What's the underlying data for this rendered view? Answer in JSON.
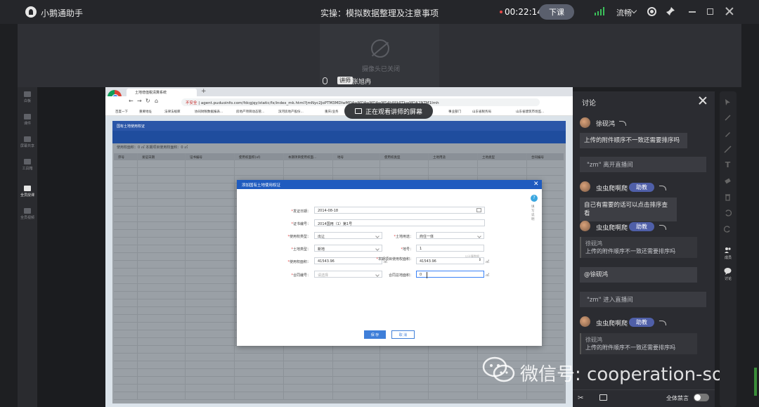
{
  "titlebar": {
    "app_name": "小鹅通助手",
    "class_title": "实操：模拟数据整理及注意事项",
    "timer": "00:22:14",
    "end_class_label": "下课",
    "quality": "流畅"
  },
  "video": {
    "camera_off": "摄像头已关闭",
    "presenter_badge": "讲师",
    "presenter_name": "张旭冉"
  },
  "left_toolbar": {
    "items": [
      {
        "label": "白板"
      },
      {
        "label": "课件"
      },
      {
        "label": "屏幕共享"
      },
      {
        "label": "工具箱"
      },
      {
        "label": "全员授课"
      },
      {
        "label": "全员视频"
      }
    ]
  },
  "browser": {
    "tab_title": "土地增值税清算系统",
    "url_warning": "不安全",
    "url": "agent.puduoinfo.com/fdcgjqy/static/fx/index_mk.html?jmNyc2JoPTM3MDIwMDAwMDAwMDAwMS4hWlkPTkwMDA2NTM1Imh"
  },
  "bookmarks": [
    "百度一下",
    "重要地址",
    "法律法规库",
    "协同财税数据报表...",
    "房地产项目动态管...",
    "滨河房地产股份...",
    "重庆/业务",
    "事业部门",
    "山东省税务局",
    "山东省建筑市场监..."
  ],
  "screen_share_banner": "正在观看讲师的屏幕",
  "app": {
    "header": "国有土地使用权证",
    "summary": "使用权面积：0 ㎡  本期项目使用权面积：0 ㎡",
    "grid_columns": [
      "序号",
      "发证日期",
      "证书编号",
      "使用权面积(㎡)",
      "本期项目使用权面...",
      "地号",
      "使用权类型",
      "土地用途",
      "土地类型",
      "合同编号"
    ]
  },
  "modal": {
    "title": "添加国有土地使用权证",
    "fields": {
      "issue_date_label": "发证日期：",
      "issue_date": "2014-08-18",
      "cert_no_label": "证书编号：",
      "cert_no": "2014国用（1）第1号",
      "use_type_label": "使用权类型：",
      "use_type": "出让",
      "land_use_label": "土地用途：",
      "land_use": "商住一体",
      "land_type_label": "土地类型：",
      "land_type": "新地",
      "parcel_label": "地号：",
      "parcel": "1",
      "area_label": "使用权面积：",
      "area": "41543.96",
      "project_area_label": "本期项目使用权面积：",
      "project_area": "41543.96",
      "contract_label": "合同编号：",
      "contract_placeholder": "请选择",
      "contract_area_label": "合同总地面积：",
      "contract_area": "0",
      "unit": "㎡"
    },
    "help_text": "填写说明",
    "hint": "以计算数据",
    "save": "保 存",
    "cancel": "取 消"
  },
  "discussion": {
    "title": "讨论",
    "messages": [
      {
        "user": "徐砚鸿",
        "text": "上传的附件顺序不一致还需要排序吗"
      },
      {
        "system": "\"zm\"  离开直播间"
      },
      {
        "user": "虫虫爬啊爬",
        "badge": "助教",
        "text": "自己有需要的话可以点击排序查看"
      },
      {
        "user": "虫虫爬啊爬",
        "badge": "助教",
        "quote_user": "徐砚鸿",
        "quote_text": "上传的附件顺序不一致还需要排序吗",
        "text": "@徐砚鸿"
      },
      {
        "system": "\"zm\"  进入直播间"
      },
      {
        "user": "虫虫爬啊爬",
        "badge": "助教",
        "quote_user": "徐砚鸿",
        "quote_text": "上传的附件顺序不一致还需要排序吗"
      }
    ],
    "mute_all": "全体禁言"
  },
  "right_toolbar": {
    "members": "成员",
    "discuss": "讨论"
  },
  "watermark": "微信号: cooperation-soft",
  "colors": {
    "accent_blue": "#1f5bbf",
    "badge_purple": "#4f5fa8",
    "signal_green": "#3bc05a",
    "required_red": "#e23c3c"
  }
}
